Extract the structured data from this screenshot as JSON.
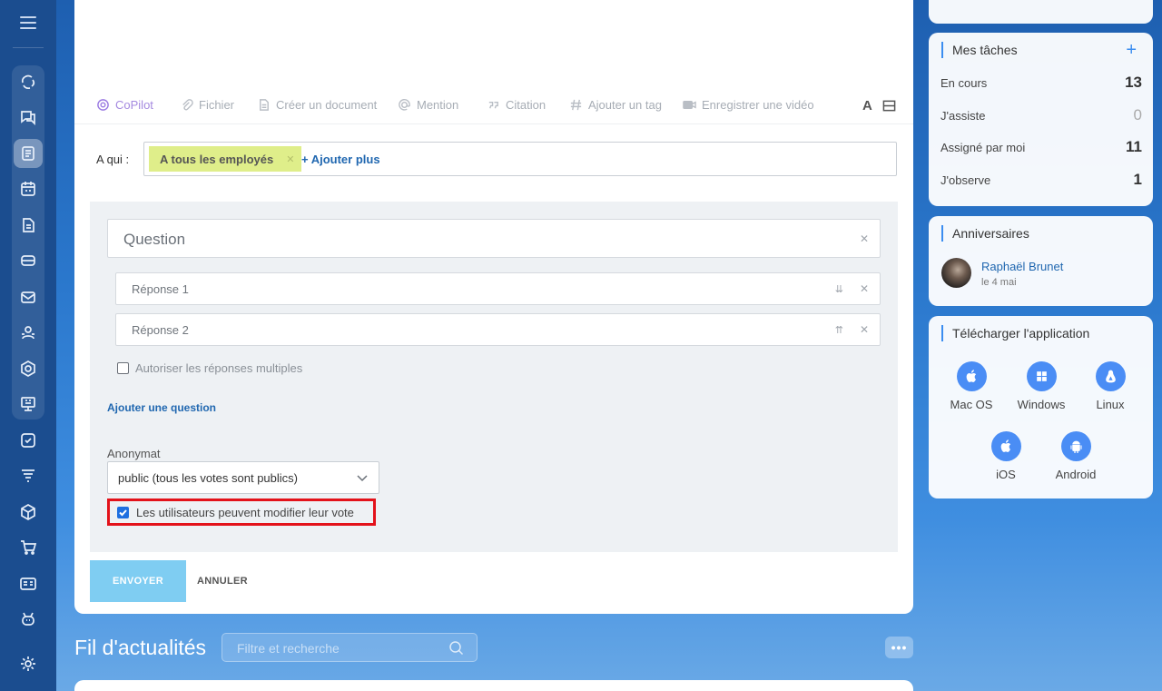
{
  "toolbar": {
    "copilot": "CoPilot",
    "file": "Fichier",
    "create_doc": "Créer un document",
    "mention": "Mention",
    "quote": "Citation",
    "add_tag": "Ajouter un tag",
    "record_video": "Enregistrer une vidéo",
    "text_format": "A"
  },
  "recipients": {
    "label": "A qui :",
    "tag": "A tous les employés",
    "add_more": "+ Ajouter plus"
  },
  "poll": {
    "question_placeholder": "Question",
    "answers": [
      "Réponse 1",
      "Réponse 2"
    ],
    "answer_arrows": [
      "⇊",
      "⇈"
    ],
    "allow_multiple": "Autoriser les réponses multiples",
    "add_question": "Ajouter une question",
    "anonymity_label": "Anonymat",
    "anonymity_value": "public (tous les votes sont publics)",
    "can_modify_vote": "Les utilisateurs peuvent modifier leur vote"
  },
  "actions": {
    "send": "ENVOYER",
    "cancel": "ANNULER"
  },
  "feed": {
    "title": "Fil d'actualités",
    "search_placeholder": "Filtre et recherche",
    "more": "•••"
  },
  "tasks": {
    "title": "Mes tâches",
    "add": "+",
    "rows": [
      {
        "label": "En cours",
        "count": "13"
      },
      {
        "label": "J'assiste",
        "count": "0"
      },
      {
        "label": "Assigné par moi",
        "count": "11"
      },
      {
        "label": "J'observe",
        "count": "1"
      }
    ]
  },
  "birthdays": {
    "title": "Anniversaires",
    "name": "Raphaël Brunet",
    "date": "le 4 mai"
  },
  "download": {
    "title": "Télécharger l'application",
    "apps": [
      "Mac OS",
      "Windows",
      "Linux",
      "iOS",
      "Android"
    ]
  },
  "colors": {
    "accent": "#2067b0",
    "send_button": "#7fcdf2",
    "highlight_border": "#e3121a",
    "tag_bg": "#dfee8a"
  }
}
